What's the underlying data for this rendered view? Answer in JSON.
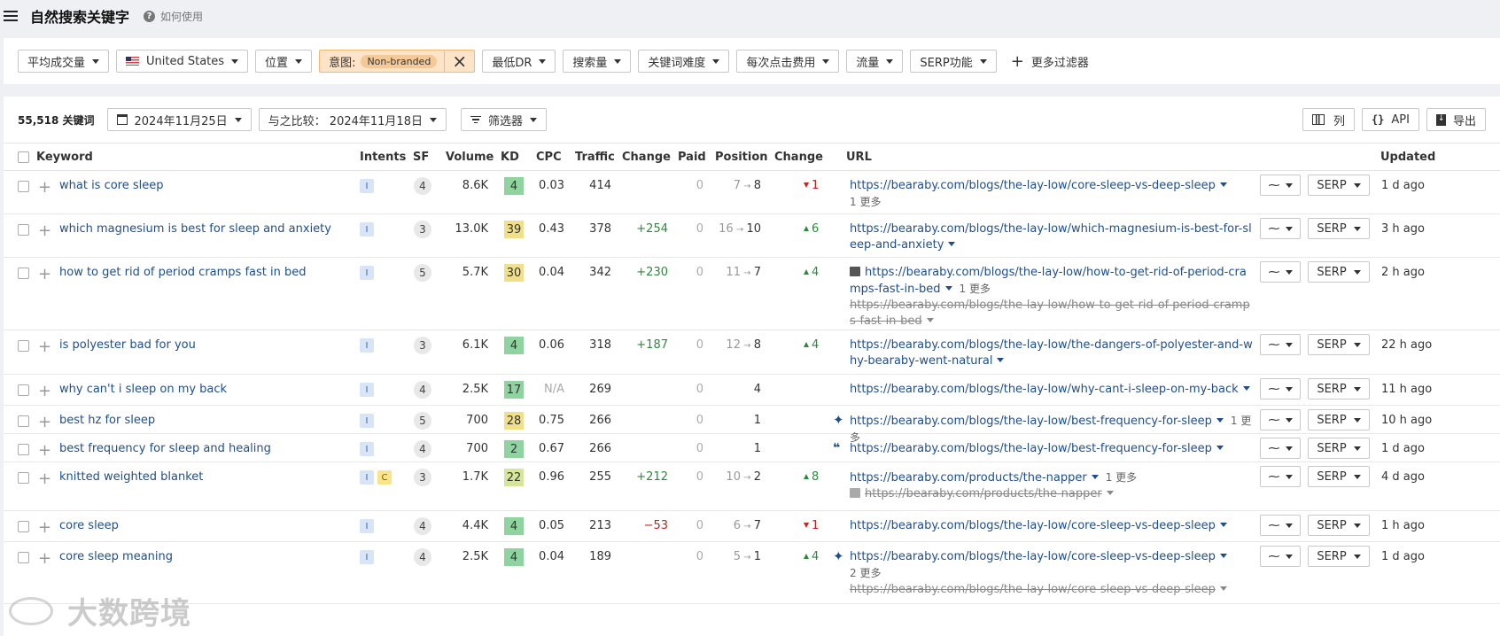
{
  "header": {
    "title": "自然搜索关键字",
    "help": "如何使用"
  },
  "filters": {
    "avg_volume": "平均成交量",
    "country": "United States",
    "position": "位置",
    "intent_label": "意图:",
    "intent_value": "Non-branded",
    "min_dr": "最低DR",
    "search_volume": "搜索量",
    "kd": "关键词难度",
    "cpc": "每次点击费用",
    "traffic": "流量",
    "serp": "SERP功能",
    "more": "更多过滤器"
  },
  "toolbar": {
    "count": "55,518 关键词",
    "date": "2024年11月25日",
    "compare": "与之比较： 2024年11月18日",
    "filter": "筛选器",
    "columns": "列",
    "api": "API",
    "export": "导出"
  },
  "columns": {
    "keyword": "Keyword",
    "intents": "Intents",
    "sf": "SF",
    "volume": "Volume",
    "kd": "KD",
    "cpc": "CPC",
    "traffic": "Traffic",
    "change": "Change",
    "paid": "Paid",
    "position": "Position",
    "pos_change": "Change",
    "url": "URL",
    "updated": "Updated"
  },
  "colors": {
    "accent": "#1f4e8c",
    "up": "#2a8a3a",
    "down": "#b22222",
    "kd_green": "#8fd4a0",
    "kd_yellow": "#f0e08a",
    "kd_lime": "#d5e59a"
  },
  "rows": [
    {
      "keyword": "what is core sleep",
      "intents": [
        "I"
      ],
      "sf": "4",
      "volume": "8.6K",
      "kd": "4",
      "kd_color": "#8fd4a0",
      "cpc": "0.03",
      "traffic": "414",
      "change": "",
      "paid": "0",
      "pos_old": "7",
      "pos_new": "8",
      "pos_change": "1",
      "pos_dir": "down",
      "url": "https://bearaby.com/blogs/the-lay-low/core-sleep-vs-deep-sleep",
      "more": "1 更多",
      "more_newline": true,
      "strike": "",
      "icon": "",
      "updated": "1 d ago"
    },
    {
      "keyword": "which magnesium is best for sleep and anxiety",
      "intents": [
        "I"
      ],
      "sf": "3",
      "volume": "13.0K",
      "kd": "39",
      "kd_color": "#f0e08a",
      "cpc": "0.43",
      "traffic": "378",
      "change": "+254",
      "paid": "0",
      "pos_old": "16",
      "pos_new": "10",
      "pos_change": "6",
      "pos_dir": "up",
      "url": "https://bearaby.com/blogs/the-lay-low/which-magnesium-is-best-for-sleep-and-anxiety",
      "more": "",
      "strike": "",
      "icon": "",
      "updated": "3 h ago"
    },
    {
      "keyword": "how to get rid of period cramps fast in bed",
      "intents": [
        "I"
      ],
      "sf": "5",
      "volume": "5.7K",
      "kd": "30",
      "kd_color": "#f0e08a",
      "cpc": "0.04",
      "traffic": "342",
      "change": "+230",
      "paid": "0",
      "pos_old": "11",
      "pos_new": "7",
      "pos_change": "4",
      "pos_dir": "up",
      "url": "https://bearaby.com/blogs/the-lay-low/how-to-get-rid-of-period-cramps-fast-in-bed",
      "more": "1 更多",
      "strike": "https://bearaby.com/blogs/the-lay-low/how-to-get-rid-of-period-cramps-fast-in-bed",
      "icon": "image",
      "updated": "2 h ago"
    },
    {
      "keyword": "is polyester bad for you",
      "intents": [
        "I"
      ],
      "sf": "3",
      "volume": "6.1K",
      "kd": "4",
      "kd_color": "#8fd4a0",
      "cpc": "0.06",
      "traffic": "318",
      "change": "+187",
      "paid": "0",
      "pos_old": "12",
      "pos_new": "8",
      "pos_change": "4",
      "pos_dir": "up",
      "url": "https://bearaby.com/blogs/the-lay-low/the-dangers-of-polyester-and-why-bearaby-went-natural",
      "more": "",
      "strike": "",
      "icon": "",
      "updated": "22 h ago"
    },
    {
      "keyword": "why can't i sleep on my back",
      "intents": [
        "I"
      ],
      "sf": "4",
      "volume": "2.5K",
      "kd": "17",
      "kd_color": "#8fd4a0",
      "cpc": "N/A",
      "traffic": "269",
      "change": "",
      "paid": "0",
      "pos_old": "",
      "pos_new": "4",
      "pos_change": "",
      "pos_dir": "",
      "url": "https://bearaby.com/blogs/the-lay-low/why-cant-i-sleep-on-my-back",
      "more": "",
      "strike": "",
      "icon": "",
      "updated": "11 h ago"
    },
    {
      "keyword": "best hz for sleep",
      "intents": [
        "I"
      ],
      "sf": "5",
      "volume": "700",
      "kd": "28",
      "kd_color": "#f0e08a",
      "cpc": "0.75",
      "traffic": "266",
      "change": "",
      "paid": "0",
      "pos_old": "",
      "pos_new": "1",
      "pos_change": "",
      "pos_dir": "",
      "url": "https://bearaby.com/blogs/the-lay-low/best-frequency-for-sleep",
      "more": "1 更多",
      "strike": "",
      "icon": "star",
      "updated": "10 h ago"
    },
    {
      "keyword": "best frequency for sleep and healing",
      "intents": [
        "I"
      ],
      "sf": "4",
      "volume": "700",
      "kd": "2",
      "kd_color": "#8fd4a0",
      "cpc": "0.67",
      "traffic": "266",
      "change": "",
      "paid": "0",
      "pos_old": "",
      "pos_new": "1",
      "pos_change": "",
      "pos_dir": "",
      "url": "https://bearaby.com/blogs/the-lay-low/best-frequency-for-sleep",
      "more": "",
      "strike": "",
      "icon": "quote",
      "updated": "1 d ago"
    },
    {
      "keyword": "knitted weighted blanket",
      "intents": [
        "I",
        "C"
      ],
      "sf": "3",
      "volume": "1.7K",
      "kd": "22",
      "kd_color": "#d5e59a",
      "cpc": "0.96",
      "traffic": "255",
      "change": "+212",
      "paid": "0",
      "pos_old": "10",
      "pos_new": "2",
      "pos_change": "8",
      "pos_dir": "up",
      "url": "https://bearaby.com/products/the-napper",
      "more": "1 更多",
      "strike": "https://bearaby.com/products/the-napper",
      "strike_icon": true,
      "icon": "",
      "updated": "4 d ago"
    },
    {
      "keyword": "core sleep",
      "intents": [
        "I"
      ],
      "sf": "4",
      "volume": "4.4K",
      "kd": "4",
      "kd_color": "#8fd4a0",
      "cpc": "0.05",
      "traffic": "213",
      "change": "−53",
      "paid": "0",
      "pos_old": "6",
      "pos_new": "7",
      "pos_change": "1",
      "pos_dir": "down",
      "url": "https://bearaby.com/blogs/the-lay-low/core-sleep-vs-deep-sleep",
      "more": "",
      "strike": "",
      "icon": "",
      "updated": "1 h ago"
    },
    {
      "keyword": "core sleep meaning",
      "intents": [
        "I"
      ],
      "sf": "4",
      "volume": "2.5K",
      "kd": "4",
      "kd_color": "#8fd4a0",
      "cpc": "0.04",
      "traffic": "189",
      "change": "",
      "paid": "0",
      "pos_old": "5",
      "pos_new": "1",
      "pos_change": "4",
      "pos_dir": "up",
      "url": "https://bearaby.com/blogs/the-lay-low/core-sleep-vs-deep-sleep",
      "more": "2 更多",
      "more_newline": true,
      "strike": "https://bearaby.com/blogs/the-lay-low/core-sleep-vs-deep-sleep",
      "icon": "star",
      "updated": "1 d ago"
    }
  ],
  "watermark": "大数跨境"
}
